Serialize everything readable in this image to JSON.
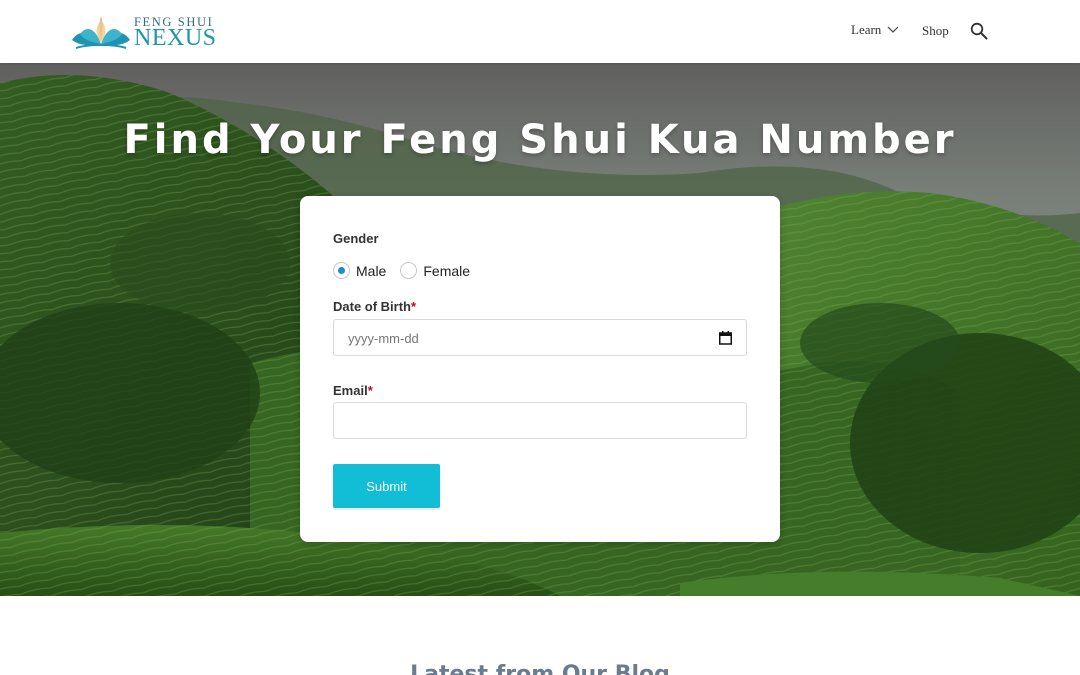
{
  "header": {
    "logo_top": "FENG SHUI",
    "logo_bottom": "NEXUS",
    "nav": {
      "learn": "Learn",
      "shop": "Shop"
    },
    "icons": [
      "lotus-logo-icon",
      "chevron-down-icon",
      "search-icon"
    ]
  },
  "hero": {
    "title": "Find Your Feng Shui Kua Number"
  },
  "form": {
    "gender_label": "Gender",
    "gender_options": [
      "Male",
      "Female"
    ],
    "gender_selected": "Male",
    "dob_label": "Date of Birth",
    "dob_placeholder": "yyyy-mm-dd",
    "email_label": "Email",
    "email_value": "",
    "required_marker": "*",
    "submit_label": "Submit"
  },
  "blog": {
    "heading": "Latest from Our Blog"
  },
  "colors": {
    "accent": "#12bdd6",
    "radio_selected": "#1a8ec6",
    "required": "#d0021b",
    "logo_teal": "#1f94b1"
  }
}
